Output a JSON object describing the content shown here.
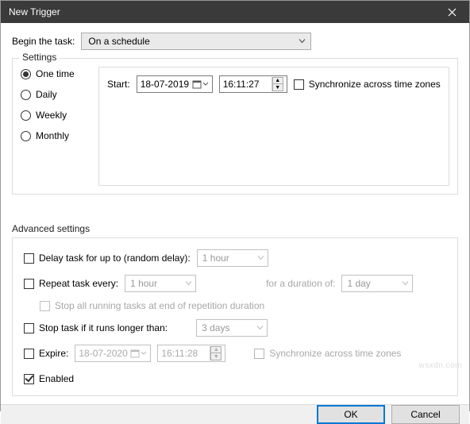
{
  "window": {
    "title": "New Trigger"
  },
  "begin": {
    "label": "Begin the task:",
    "selected": "On a schedule"
  },
  "settings": {
    "legend": "Settings",
    "schedule": {
      "options": [
        "One time",
        "Daily",
        "Weekly",
        "Monthly"
      ],
      "selected": "One time"
    },
    "start": {
      "label": "Start:",
      "date": "18-07-2019",
      "time": "16:11:27",
      "sync_label": "Synchronize across time zones",
      "sync_checked": false
    }
  },
  "advanced": {
    "legend": "Advanced settings",
    "delay": {
      "label": "Delay task for up to (random delay):",
      "checked": false,
      "value": "1 hour"
    },
    "repeat": {
      "label": "Repeat task every:",
      "checked": false,
      "value": "1 hour",
      "duration_label": "for a duration of:",
      "duration_value": "1 day"
    },
    "stop_rep": {
      "label": "Stop all running tasks at end of repetition duration"
    },
    "stop_long": {
      "label": "Stop task if it runs longer than:",
      "checked": false,
      "value": "3 days"
    },
    "expire": {
      "label": "Expire:",
      "checked": false,
      "date": "18-07-2020",
      "time": "16:11:28",
      "sync_label": "Synchronize across time zones"
    },
    "enabled": {
      "label": "Enabled",
      "checked": true
    }
  },
  "footer": {
    "ok": "OK",
    "cancel": "Cancel"
  },
  "watermark": "wsxdn.com"
}
